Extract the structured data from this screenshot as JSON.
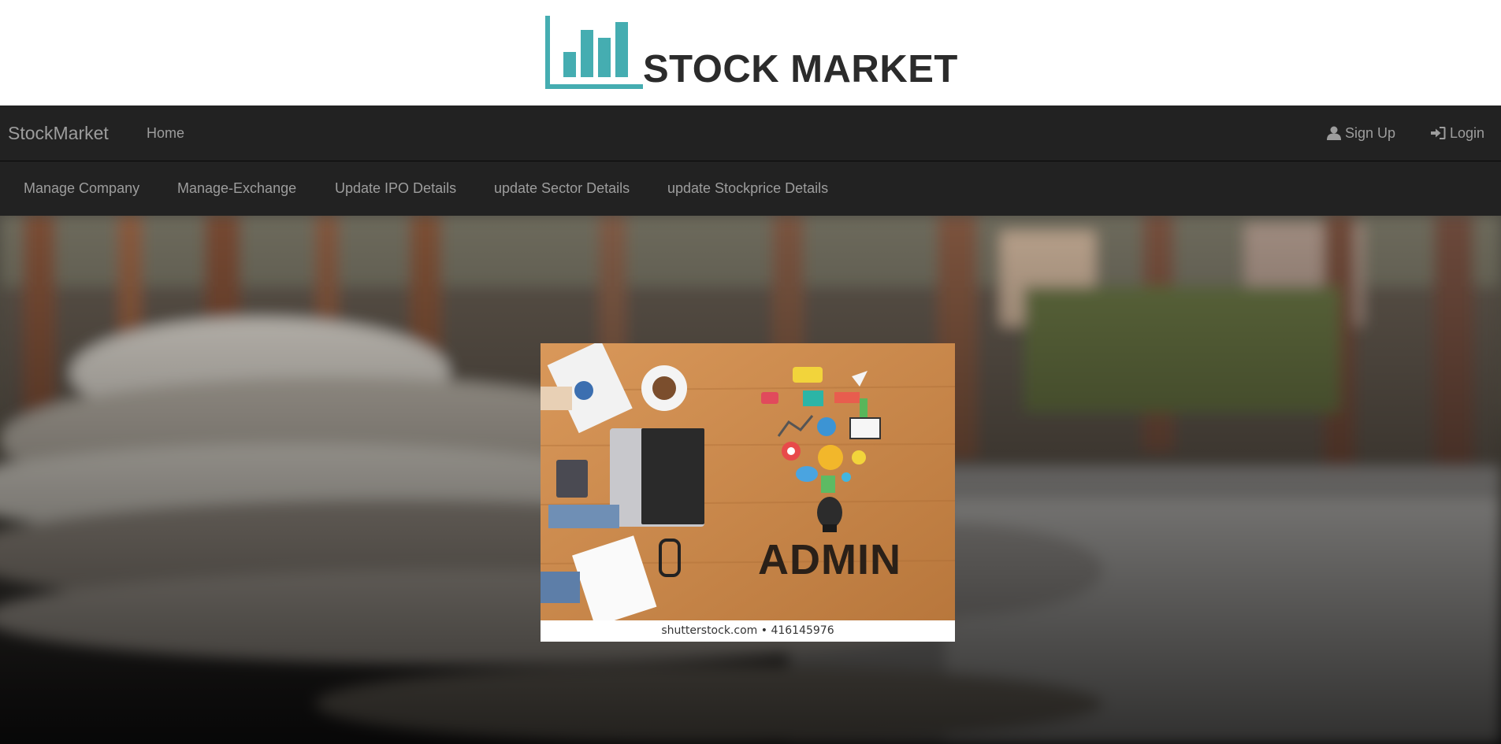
{
  "header": {
    "logo_title": "STOCK MARKET"
  },
  "navbar": {
    "brand": "StockMarket",
    "home": "Home",
    "sign_up": "Sign Up",
    "login": "Login"
  },
  "subnav": {
    "items": [
      "Manage Company",
      "Manage-Exchange",
      "Update IPO Details",
      "update Sector Details",
      "update Stockprice Details"
    ]
  },
  "hero": {
    "card_text": "ADMIN",
    "watermark": "shutterstock.com • 416145976"
  },
  "colors": {
    "logo_accent": "#45adb1",
    "navbar_bg": "#222222",
    "nav_text": "#9d9d9d",
    "title_text": "#2b2b2b"
  },
  "icons": {
    "sign_up": "user-icon",
    "login": "log-in-icon"
  }
}
